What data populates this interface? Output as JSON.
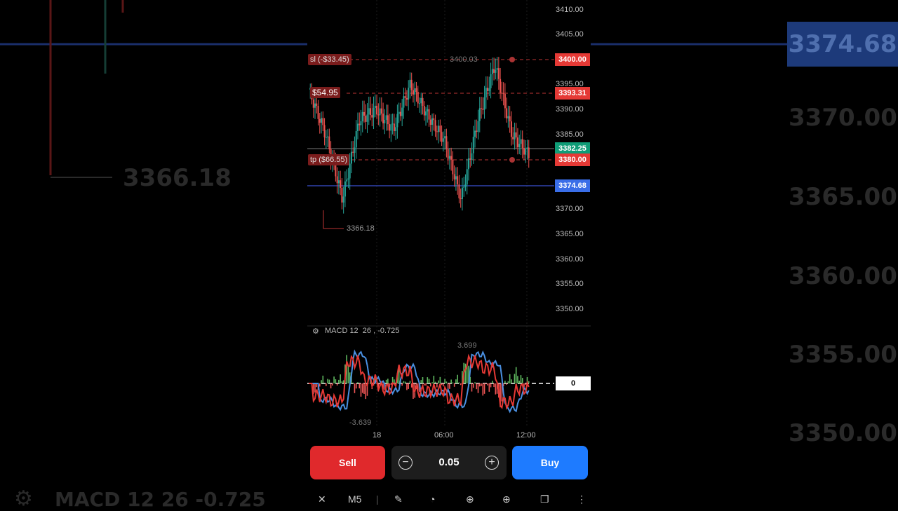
{
  "background": {
    "left_levels": [
      {
        "label": "3366.18"
      }
    ],
    "right_levels": [
      {
        "label": "3370.00"
      },
      {
        "label": "3365.00"
      },
      {
        "label": "3360.00"
      },
      {
        "label": "3355.00"
      },
      {
        "label": "3350.00"
      }
    ],
    "badge": "3374.68",
    "bottom_text": "MACD 12  26  -0.725"
  },
  "chart": {
    "y_axis": [
      "3410.00",
      "3405.00",
      "3400.00",
      "3395.00",
      "3390.00",
      "3385.00",
      "3380.00",
      "3375.00",
      "3370.00",
      "3365.00",
      "3360.00",
      "3355.00",
      "3350.00"
    ],
    "x_axis": [
      "18",
      "06:00",
      "12:00"
    ],
    "high_label": "3400.03",
    "low_label": "3366.18",
    "sl": {
      "label": "sl (-$33.45)",
      "price": "3400.00"
    },
    "entry": {
      "label": "$54.95",
      "price": "3393.31"
    },
    "tp": {
      "label": "tp ($66.55)",
      "price": "3380.00"
    },
    "current": {
      "price": "3382.25"
    },
    "alert": {
      "price": "3374.68"
    },
    "colors": {
      "up": "#26a69a",
      "down": "#ef5350",
      "sl_tag": "#e53935",
      "current_tag": "#0f9d77",
      "alert_tag": "#3a6ee8"
    }
  },
  "chart_data": {
    "type": "line",
    "title": "",
    "x": [
      "18",
      "06:00",
      "12:00"
    ],
    "series": [
      {
        "name": "",
        "values": [
          3394,
          3385,
          3372,
          3388,
          3390,
          3386,
          3395,
          3389,
          3384,
          3372,
          3388,
          3399,
          3385,
          3381
        ]
      }
    ],
    "ylim": [
      3348,
      3412
    ]
  },
  "indicator": {
    "title": "MACD 12  26 , -0.725",
    "max_label": "3.699",
    "min_label": "-3.639",
    "zero_label": "0"
  },
  "controls": {
    "sell": "Sell",
    "buy": "Buy",
    "lot": "0.05",
    "minus": "−",
    "plus": "+",
    "timeframe": "M5"
  }
}
